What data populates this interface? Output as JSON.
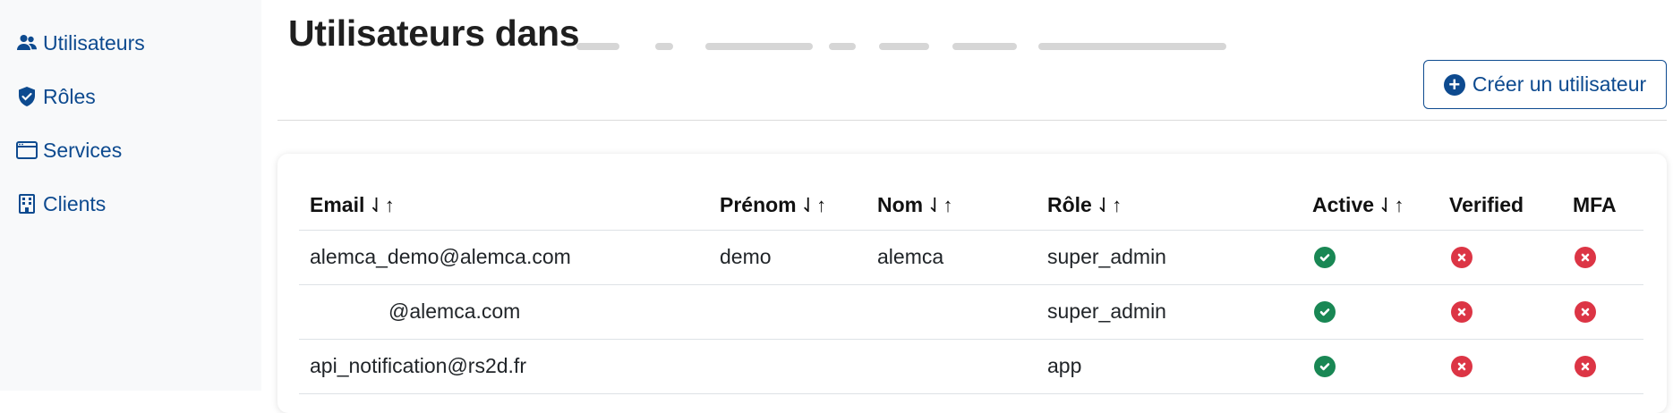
{
  "sidebar": {
    "items": [
      {
        "label": "Utilisateurs",
        "icon": "users-icon"
      },
      {
        "label": "Rôles",
        "icon": "shield-icon"
      },
      {
        "label": "Services",
        "icon": "window-icon"
      },
      {
        "label": "Clients",
        "icon": "building-icon"
      }
    ]
  },
  "header": {
    "title": "Utilisateurs dans",
    "create_button": "Créer un utilisateur"
  },
  "table": {
    "columns": [
      "Email",
      "Prénom",
      "Nom",
      "Rôle",
      "Active",
      "Verified",
      "MFA"
    ],
    "sort_glyph": "⇃↑",
    "rows": [
      {
        "email": "alemca_demo@alemca.com",
        "prenom": "demo",
        "nom": "alemca",
        "role": "super_admin",
        "active": true,
        "verified": false,
        "mfa": false
      },
      {
        "email": "@alemca.com",
        "prenom": "",
        "nom": "",
        "role": "super_admin",
        "active": true,
        "verified": false,
        "mfa": false
      },
      {
        "email": "api_notification@rs2d.fr",
        "prenom": "",
        "nom": "",
        "role": "app",
        "active": true,
        "verified": false,
        "mfa": false
      }
    ]
  },
  "colors": {
    "accent": "#0d4a8f",
    "success": "#198754",
    "danger": "#dc3545",
    "sidebar_bg": "#f8f9fa"
  }
}
